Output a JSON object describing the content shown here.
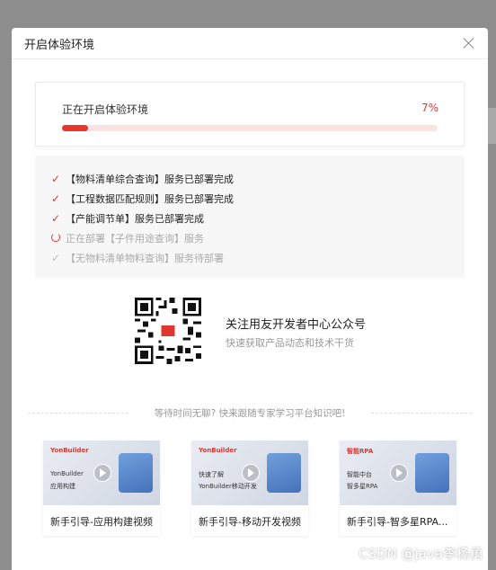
{
  "modal": {
    "title": "开启体验环境"
  },
  "progress": {
    "label": "正在开启体验环境",
    "percent_text": "7%",
    "value": 0.07
  },
  "steps": [
    {
      "text": "【物料清单综合查询】服务已部署完成",
      "status": "done"
    },
    {
      "text": "【工程数据匹配规则】服务已部署完成",
      "status": "done"
    },
    {
      "text": "【产能调节单】服务已部署完成",
      "status": "done"
    },
    {
      "text": "正在部署【子件用途查询】服务",
      "status": "loading"
    },
    {
      "text": "【无物料清单物料查询】服务待部署",
      "status": "pending"
    }
  ],
  "qr": {
    "title": "关注用友开发者中心公众号",
    "subtitle": "快速获取产品动态和技术干货"
  },
  "wait": {
    "text": "等待时间无聊? 快来跟随专家学习平台知识吧!"
  },
  "videos": [
    {
      "brand": "YonBuilder",
      "line1": "YonBuilder",
      "line2": "应用构建",
      "title": "新手引导-应用构建视频"
    },
    {
      "brand": "YonBuilder",
      "line1": "快速了解",
      "line2": "YonBuilder移动开发",
      "title": "新手引导-移动开发视频"
    },
    {
      "brand": "智能RPA",
      "line1": "智能中台",
      "line2": "智多星RPA",
      "title": "新手引导-智多星RPA..."
    }
  ],
  "watermark": "CSDN @java李杨勇",
  "colors": {
    "accent": "#e8352f"
  }
}
